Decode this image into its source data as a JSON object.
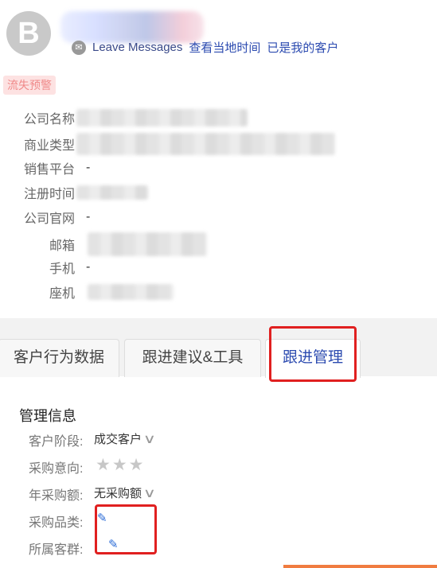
{
  "profile": {
    "avatar_letter": "B",
    "leave_messages": "Leave Messages",
    "local_time_link": "查看当地时间",
    "my_customer_link": "已是我的客户"
  },
  "badge": "流失预警",
  "info": {
    "company_name_label": "公司名称",
    "business_type_label": "商业类型",
    "sales_platform_label": "销售平台",
    "sales_platform_value": "-",
    "register_time_label": "注册时间",
    "website_label": "公司官网",
    "website_value": "-",
    "email_label": "邮箱",
    "mobile_label": "手机",
    "mobile_value": "-",
    "landline_label": "座机"
  },
  "tabs": [
    {
      "label": "客户行为数据"
    },
    {
      "label": "跟进建议&工具"
    },
    {
      "label": "跟进管理"
    }
  ],
  "management": {
    "title": "管理信息",
    "stage_label": "客户阶段:",
    "stage_value": "成交客户",
    "intent_label": "采购意向:",
    "intent_stars": "★★★",
    "annual_label": "年采购额:",
    "annual_value": "无采购额",
    "category_label": "采购品类:",
    "group_label": "所属客群:"
  },
  "colors": {
    "accent": "#2c4bb0",
    "highlight_box": "#e02020",
    "badge_bg": "#fde2e2"
  }
}
